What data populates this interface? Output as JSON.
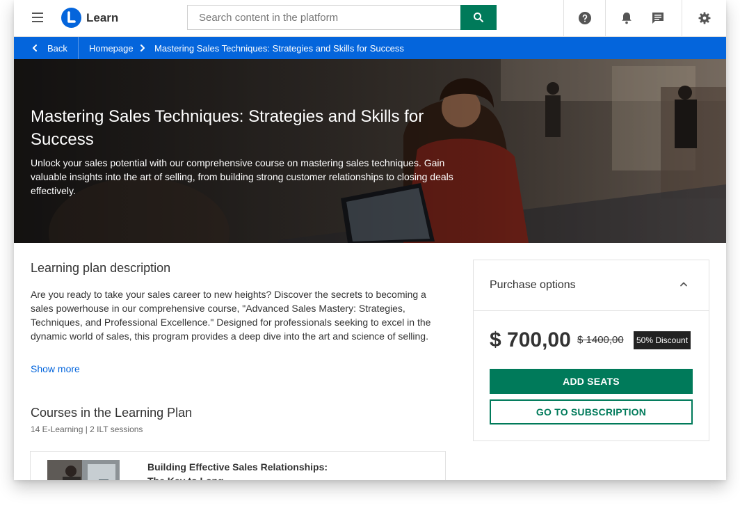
{
  "header": {
    "brand": "Learn",
    "search_placeholder": "Search content in the platform",
    "icons": [
      "menu-icon",
      "search-icon",
      "help-icon",
      "bell-icon",
      "chat-icon",
      "gear-icon"
    ]
  },
  "breadcrumb": {
    "back": "Back",
    "home": "Homepage",
    "current": "Mastering Sales Techniques: Strategies and Skills for Success"
  },
  "hero": {
    "title": "Mastering Sales Techniques: Strategies and Skills for Success",
    "description": "Unlock your sales potential with our comprehensive course on mastering sales techniques. Gain valuable insights into the art of selling, from building strong customer relationships to closing deals effectively."
  },
  "plan": {
    "heading": "Learning plan description",
    "description": "Are you ready to take your sales career to new heights? Discover the secrets to becoming a sales powerhouse in our comprehensive course, \"Advanced Sales Mastery: Strategies, Techniques, and Professional Excellence.\" Designed for professionals seeking to excel in the dynamic world of sales, this program provides a deep dive into the art and science of selling.",
    "show_more": "Show more"
  },
  "courses": {
    "heading": "Courses in the Learning Plan",
    "meta": "14 E-Learning | 2 ILT sessions",
    "items": [
      {
        "title": "Building Effective Sales Relationships: The Key to Long"
      }
    ]
  },
  "purchase": {
    "title": "Purchase options",
    "price": "$ 700,00",
    "old_price": "$ 1400,00",
    "discount": "50% Discount",
    "add_seats": "ADD SEATS",
    "go_subscription": "GO TO SUBSCRIPTION"
  },
  "colors": {
    "brand_blue": "#0465dc",
    "primary_green": "#007a5a"
  }
}
